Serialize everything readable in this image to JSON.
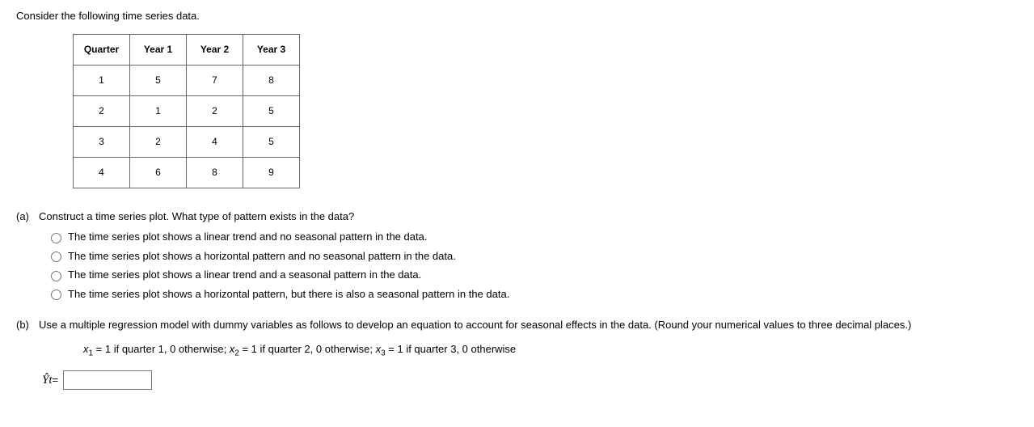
{
  "intro": "Consider the following time series data.",
  "table": {
    "headers": [
      "Quarter",
      "Year 1",
      "Year 2",
      "Year 3"
    ],
    "rows": [
      [
        "1",
        "5",
        "7",
        "8"
      ],
      [
        "2",
        "1",
        "2",
        "5"
      ],
      [
        "3",
        "2",
        "4",
        "5"
      ],
      [
        "4",
        "6",
        "8",
        "9"
      ]
    ]
  },
  "partA": {
    "label": "(a)",
    "question": "Construct a time series plot. What type of pattern exists in the data?",
    "options": [
      "The time series plot shows a linear trend and no seasonal pattern in the data.",
      "The time series plot shows a horizontal pattern and no seasonal pattern in the data.",
      "The time series plot shows a linear trend and a seasonal pattern in the data.",
      "The time series plot shows a horizontal pattern, but there is also a seasonal pattern in the data."
    ]
  },
  "partB": {
    "label": "(b)",
    "question": "Use a multiple regression model with dummy variables as follows to develop an equation to account for seasonal effects in the data. (Round your numerical values to three decimal places.)",
    "dummy_pre1": "x",
    "dummy_sub1": "1",
    "dummy_txt1": " = 1 if quarter 1, 0 otherwise; ",
    "dummy_pre2": "x",
    "dummy_sub2": "2",
    "dummy_txt2": " = 1 if quarter 2, 0 otherwise; ",
    "dummy_pre3": "x",
    "dummy_sub3": "3",
    "dummy_txt3": " = 1 if quarter 3, 0 otherwise",
    "yhat": "Ŷ",
    "yhat_sub": "t",
    "equals": " = ",
    "input_value": ""
  },
  "chart_data": {
    "type": "table",
    "title": "Quarterly time series data over 3 years",
    "categories": [
      "Q1",
      "Q2",
      "Q3",
      "Q4"
    ],
    "series": [
      {
        "name": "Year 1",
        "values": [
          5,
          1,
          2,
          6
        ]
      },
      {
        "name": "Year 2",
        "values": [
          7,
          2,
          4,
          8
        ]
      },
      {
        "name": "Year 3",
        "values": [
          8,
          5,
          5,
          9
        ]
      }
    ]
  }
}
